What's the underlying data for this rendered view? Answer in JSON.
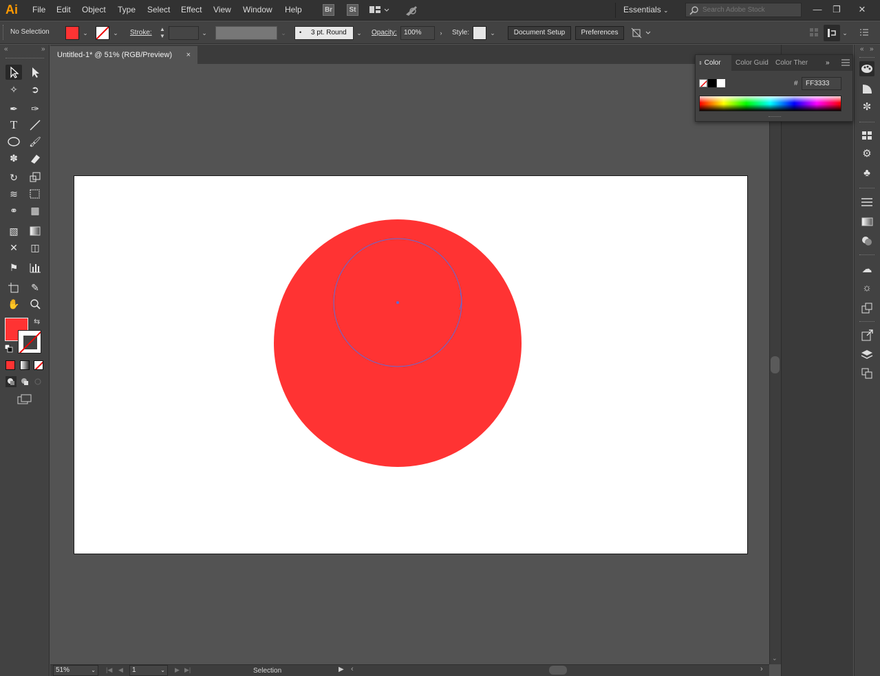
{
  "app": {
    "logo": "Ai"
  },
  "menu": [
    "File",
    "Edit",
    "Object",
    "Type",
    "Select",
    "Effect",
    "View",
    "Window",
    "Help"
  ],
  "bridge": {
    "br": "Br",
    "st": "St"
  },
  "workspace": {
    "label": "Essentials",
    "search_placeholder": "Search Adobe Stock"
  },
  "control": {
    "selection": "No Selection",
    "stroke_label": "Stroke:",
    "brush": "3 pt. Round",
    "opacity_label": "Opacity:",
    "opacity_value": "100%",
    "style_label": "Style:",
    "document_setup": "Document Setup",
    "preferences": "Preferences"
  },
  "document": {
    "tab_title": "Untitled-1* @ 51% (RGB/Preview)",
    "close": "×"
  },
  "status": {
    "zoom": "51%",
    "page": "1",
    "tool": "Selection"
  },
  "color_panel": {
    "tabs": [
      "Color",
      "Color Guid",
      "Color Ther"
    ],
    "hex_prefix": "#",
    "hex_value": "FF3333"
  },
  "colors": {
    "fill": "#ff3333",
    "guide": "#5b6bd8",
    "ui_bg": "#535353",
    "accent_logo": "#ff9a00"
  },
  "artwork": {
    "shape": "circle",
    "fill": "#FF3333",
    "diameter_pt": 700
  }
}
